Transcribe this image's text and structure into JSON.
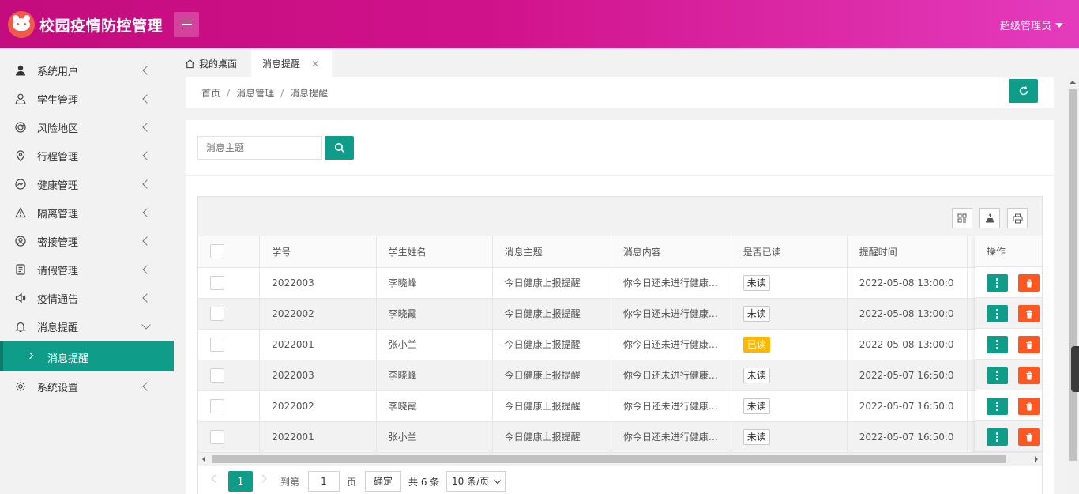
{
  "header": {
    "app_title": "校园疫情防控管理",
    "user_menu": "超级管理员"
  },
  "sidebar": {
    "items": [
      {
        "label": "系统用户",
        "icon": "user-solid-icon"
      },
      {
        "label": "学生管理",
        "icon": "user-icon"
      },
      {
        "label": "风险地区",
        "icon": "radar-icon"
      },
      {
        "label": "行程管理",
        "icon": "location-icon"
      },
      {
        "label": "健康管理",
        "icon": "health-chart-icon"
      },
      {
        "label": "隔离管理",
        "icon": "warning-icon"
      },
      {
        "label": "密接管理",
        "icon": "user-circle-icon"
      },
      {
        "label": "请假管理",
        "icon": "document-icon"
      },
      {
        "label": "疫情通告",
        "icon": "speaker-icon"
      },
      {
        "label": "消息提醒",
        "icon": "bell-icon"
      },
      {
        "label": "系统设置",
        "icon": "gear-icon"
      }
    ],
    "active_sub": "消息提醒"
  },
  "tabs": {
    "home": "我的桌面",
    "active": "消息提醒"
  },
  "breadcrumb": [
    "首页",
    "消息管理",
    "消息提醒"
  ],
  "search": {
    "placeholder": "消息主题"
  },
  "table": {
    "columns": [
      "学号",
      "学生姓名",
      "消息主题",
      "消息内容",
      "是否已读",
      "提醒时间",
      "操作"
    ],
    "rows": [
      {
        "id": "2022003",
        "name": "李晓峰",
        "subject": "今日健康上报提醒",
        "content": "你今日还未进行健康…",
        "status": "未读",
        "time": "2022-05-08 13:00:0"
      },
      {
        "id": "2022002",
        "name": "李晓霞",
        "subject": "今日健康上报提醒",
        "content": "你今日还未进行健康…",
        "status": "未读",
        "time": "2022-05-08 13:00:0"
      },
      {
        "id": "2022001",
        "name": "张小兰",
        "subject": "今日健康上报提醒",
        "content": "你今日还未进行健康…",
        "status": "已读",
        "time": "2022-05-08 13:00:0"
      },
      {
        "id": "2022003",
        "name": "李晓峰",
        "subject": "今日健康上报提醒",
        "content": "你今日还未进行健康…",
        "status": "未读",
        "time": "2022-05-07 16:50:0"
      },
      {
        "id": "2022002",
        "name": "李晓霞",
        "subject": "今日健康上报提醒",
        "content": "你今日还未进行健康…",
        "status": "未读",
        "time": "2022-05-07 16:50:0"
      },
      {
        "id": "2022001",
        "name": "张小兰",
        "subject": "今日健康上报提醒",
        "content": "你今日还未进行健康…",
        "status": "未读",
        "time": "2022-05-07 16:50:0"
      }
    ]
  },
  "pager": {
    "current": "1",
    "goto_label": "到第",
    "page_input": "1",
    "page_unit": "页",
    "confirm": "确定",
    "total": "共 6 条",
    "page_size": "10 条/页"
  },
  "colors": {
    "header_start": "#c40c7e",
    "header_end": "#e43bbd",
    "primary": "#0f9d8a",
    "danger": "#ff5722",
    "warn": "#ffb800"
  }
}
